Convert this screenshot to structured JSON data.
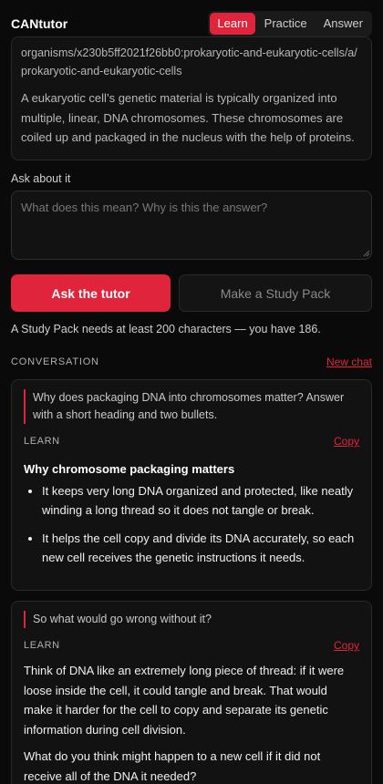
{
  "app": {
    "brand": "CANtutor"
  },
  "tabs": [
    {
      "label": "Learn",
      "active": true
    },
    {
      "label": "Practice",
      "active": false
    },
    {
      "label": "Answer",
      "active": false
    }
  ],
  "source": {
    "url_text": "organisms/x230b5ff2021f26bb0:prokaryotic-and-eukaryotic-cells/a/prokaryotic-and-eukaryotic-cells",
    "body": "A eukaryotic cell’s genetic material is typically organized into multiple, linear, DNA chromosomes. These chromosomes are coiled up and packaged in the nucleus with the help of proteins."
  },
  "ask": {
    "label": "Ask about it",
    "placeholder": "What does this mean? Why is this the answer?",
    "value": ""
  },
  "buttons": {
    "ask_tutor": "Ask the tutor",
    "study_pack": "Make a Study Pack"
  },
  "hint": "A Study Pack needs at least 200 characters — you have 186.",
  "conversation": {
    "title": "CONVERSATION",
    "new_chat": "New chat",
    "messages": [
      {
        "question": "Why does packaging DNA into chromosomes matter? Answer with a short heading and two bullets.",
        "mode": "LEARN",
        "copy_label": "Copy",
        "heading": "Why chromosome packaging matters",
        "bullets": [
          "It keeps very long DNA organized and protected, like neatly winding a long thread so it does not tangle or break.",
          "It helps the cell copy and divide its DNA accurately, so each new cell receives the genetic instructions it needs."
        ]
      },
      {
        "question": "So what would go wrong without it?",
        "mode": "LEARN",
        "copy_label": "Copy",
        "paragraphs": [
          "Think of DNA like an extremely long piece of thread: if it were loose inside the cell, it could tangle and break. That would make it harder for the cell to copy and separate its genetic information during cell division.",
          "What do you think might happen to a new cell if it did not receive all of the DNA it needed?"
        ]
      }
    ]
  },
  "colors": {
    "accent": "#e0243b",
    "background": "#0a0a0a",
    "card": "#121212"
  }
}
